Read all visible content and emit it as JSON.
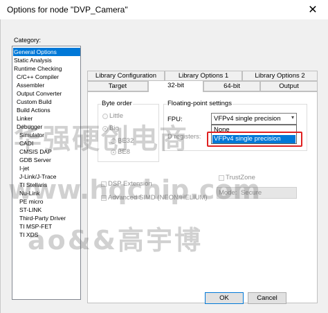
{
  "window": {
    "title": "Options for node \"DVP_Camera\"",
    "close_glyph": "✕"
  },
  "category": {
    "label": "Category:",
    "items": [
      "General Options",
      "Static Analysis",
      "Runtime Checking",
      "C/C++ Compiler",
      "Assembler",
      "Output Converter",
      "Custom Build",
      "Build Actions",
      "Linker",
      "Debugger",
      "Simulator",
      "CADI",
      "CMSIS DAP",
      "GDB Server",
      "I-jet",
      "J-Link/J-Trace",
      "TI Stellaris",
      "Nu-Link",
      "PE micro",
      "ST-LINK",
      "Third-Party Driver",
      "TI MSP-FET",
      "TI XDS"
    ],
    "selected": "General Options"
  },
  "tabs": {
    "row1": [
      "Library Configuration",
      "Library Options 1",
      "Library Options 2"
    ],
    "row2": [
      "Target",
      "32-bit",
      "64-bit",
      "Output"
    ],
    "active": "32-bit"
  },
  "byte_order": {
    "label": "Byte order",
    "little": "Little",
    "big": "Big",
    "be32": "BE32",
    "be8": "BE8"
  },
  "fp": {
    "label": "Floating-point settings",
    "fpu_label": "FPU:",
    "fpu_value": "VFPv4 single precision",
    "options": [
      "None",
      "VFPv4 single precision"
    ],
    "d_registers_label": "D registers:"
  },
  "extensions": {
    "dsp": "DSP Extension",
    "simd": "Advanced SIMD (NEON/HELIUM)",
    "trustzone": "TrustZone",
    "mode_label": "Mode:",
    "mode_value": "Secure"
  },
  "buttons": {
    "ok": "OK",
    "cancel": "Cancel"
  },
  "watermark": {
    "line1": "华强硬创电商",
    "line2": "www.hqchip.com",
    "line3": "ao&&高宇博"
  }
}
